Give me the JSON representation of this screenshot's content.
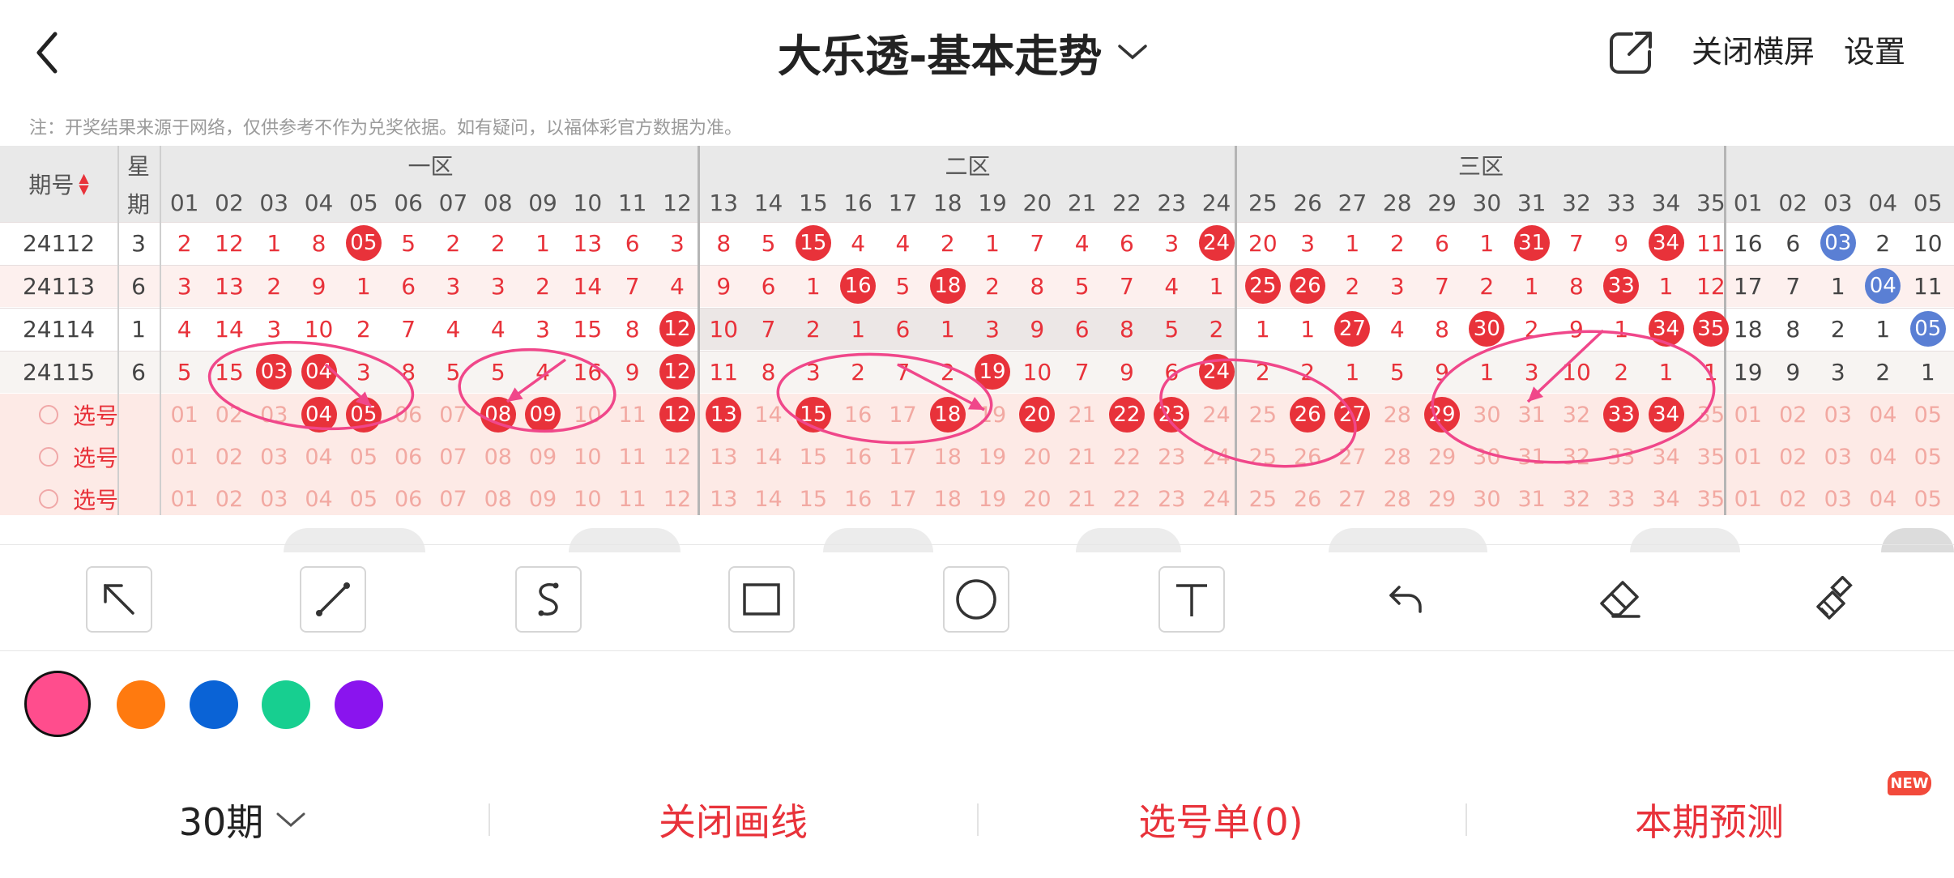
{
  "header": {
    "title": "大乐透-基本走势",
    "close_landscape": "关闭横屏",
    "settings": "设置"
  },
  "note": "注：开奖结果来源于网络，仅供参考不作为兑奖依据。如有疑问，以福体彩官方数据为准。",
  "table": {
    "col_issue": "期号",
    "col_week_top": "星",
    "col_week_bottom": "期",
    "zones": [
      "一区",
      "二区",
      "三区"
    ],
    "front_headers": [
      "01",
      "02",
      "03",
      "04",
      "05",
      "06",
      "07",
      "08",
      "09",
      "10",
      "11",
      "12",
      "13",
      "14",
      "15",
      "16",
      "17",
      "18",
      "19",
      "20",
      "21",
      "22",
      "23",
      "24",
      "25",
      "26",
      "27",
      "28",
      "29",
      "30",
      "31",
      "32",
      "33",
      "34",
      "35"
    ],
    "back_headers": [
      "01",
      "02",
      "03",
      "04",
      "05"
    ],
    "rows": [
      {
        "issue": "24112",
        "week": "3",
        "front": [
          "2",
          "12",
          "1",
          "8",
          "05",
          "5",
          "2",
          "2",
          "1",
          "13",
          "6",
          "3",
          "8",
          "5",
          "15",
          "4",
          "4",
          "2",
          "1",
          "7",
          "4",
          "6",
          "3",
          "24",
          "20",
          "3",
          "1",
          "2",
          "6",
          "1",
          "31",
          "7",
          "9",
          "34",
          "11"
        ],
        "back": [
          "16",
          "6",
          "03",
          "2",
          "10"
        ]
      },
      {
        "issue": "24113",
        "week": "6",
        "front": [
          "3",
          "13",
          "2",
          "9",
          "1",
          "6",
          "3",
          "3",
          "2",
          "14",
          "7",
          "4",
          "9",
          "6",
          "1",
          "16",
          "5",
          "18",
          "2",
          "8",
          "5",
          "7",
          "4",
          "1",
          "25",
          "26",
          "2",
          "3",
          "7",
          "2",
          "1",
          "8",
          "33",
          "1",
          "12"
        ],
        "back": [
          "17",
          "7",
          "1",
          "04",
          "11"
        ]
      },
      {
        "issue": "24114",
        "week": "1",
        "front": [
          "4",
          "14",
          "3",
          "10",
          "2",
          "7",
          "4",
          "4",
          "3",
          "15",
          "8",
          "12",
          "10",
          "7",
          "2",
          "1",
          "6",
          "1",
          "3",
          "9",
          "6",
          "8",
          "5",
          "2",
          "1",
          "1",
          "27",
          "4",
          "8",
          "30",
          "2",
          "9",
          "1",
          "34",
          "35"
        ],
        "back": [
          "18",
          "8",
          "2",
          "1",
          "05"
        ]
      },
      {
        "issue": "24115",
        "week": "6",
        "front": [
          "5",
          "15",
          "03",
          "04",
          "3",
          "8",
          "5",
          "5",
          "4",
          "16",
          "9",
          "12",
          "11",
          "8",
          "3",
          "2",
          "7",
          "2",
          "19",
          "10",
          "7",
          "9",
          "6",
          "24",
          "2",
          "2",
          "1",
          "5",
          "9",
          "1",
          "3",
          "10",
          "2",
          "1",
          "1"
        ],
        "back": [
          "19",
          "9",
          "3",
          "2",
          "1"
        ]
      }
    ],
    "select_label": "选号",
    "selected_front": [
      "04",
      "05",
      "08",
      "09",
      "12",
      "13",
      "15",
      "18",
      "20",
      "22",
      "23",
      "26",
      "27",
      "29",
      "33",
      "34"
    ]
  },
  "drawing_tools": [
    "arrow-tool",
    "line-tool",
    "curve-tool",
    "rectangle-tool",
    "circle-tool",
    "text-tool",
    "undo-tool",
    "eraser-tool",
    "clear-tool"
  ],
  "colors": [
    "#ff4d8d",
    "#ff7a0f",
    "#0a63d6",
    "#17cf90",
    "#8a14ee"
  ],
  "bottom": {
    "period": "30期",
    "close_drawing": "关闭画线",
    "selection_list": "选号单(0)",
    "prediction": "本期预测",
    "new_badge": "NEW"
  },
  "theme": {
    "red": "#e8323a",
    "blue": "#5a7fd4",
    "annot": "#f0478a",
    "select_bg": "#fdeae6"
  }
}
